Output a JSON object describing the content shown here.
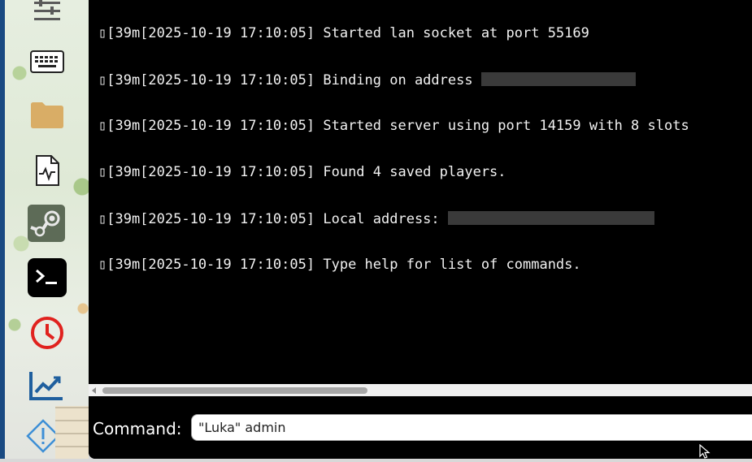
{
  "sidebar": {
    "icons": [
      {
        "name": "sliders-icon"
      },
      {
        "name": "keyboard-icon"
      },
      {
        "name": "folder-icon",
        "color": "#d9ad66"
      },
      {
        "name": "activity-file-icon"
      },
      {
        "name": "steam-icon",
        "color": "#5d6b57"
      },
      {
        "name": "terminal-icon",
        "color": "#000000"
      },
      {
        "name": "clock-icon",
        "color": "#e0221e"
      },
      {
        "name": "chart-trend-icon",
        "color": "#1f5f9e"
      },
      {
        "name": "warning-diamond-icon",
        "color": "#3d8fd6"
      }
    ]
  },
  "console": {
    "lines": [
      {
        "prefix": "▯[39m[2025-10-19 17:10:05]",
        "message": "Started lan socket at port 55169",
        "redacted_after": false
      },
      {
        "prefix": "▯[39m[2025-10-19 17:10:05]",
        "message": "Binding on address",
        "redacted_after": true
      },
      {
        "prefix": "▯[39m[2025-10-19 17:10:05]",
        "message": "Started server using port 14159 with 8 slots",
        "redacted_after": false
      },
      {
        "prefix": "▯[39m[2025-10-19 17:10:05]",
        "message": "Found 4 saved players.",
        "redacted_after": false
      },
      {
        "prefix": "▯[39m[2025-10-19 17:10:05]",
        "message": "Local address:",
        "redacted_after": true
      },
      {
        "prefix": "▯[39m[2025-10-19 17:10:05]",
        "message": "Type help for list of commands.",
        "redacted_after": false
      }
    ]
  },
  "command": {
    "label": "Command:",
    "value": "\"Luka\" admin"
  },
  "colors": {
    "console_bg": "#000000",
    "console_text": "#f2f2f2",
    "accent": "#1a4a82"
  }
}
